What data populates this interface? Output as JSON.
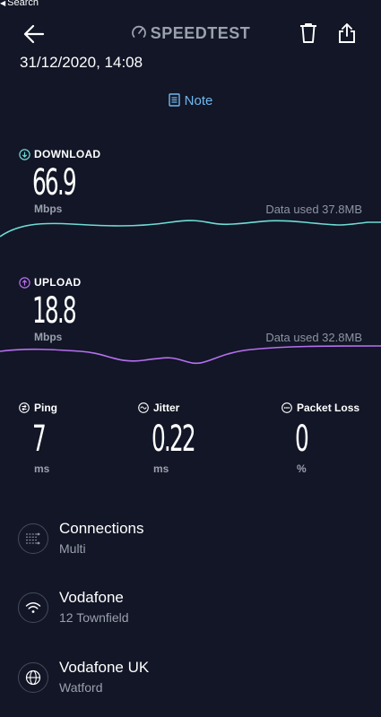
{
  "status_bar": {
    "back_label": "Search"
  },
  "header": {
    "brand": "SPEEDTEST",
    "datetime": "31/12/2020, 14:08",
    "note_label": "Note"
  },
  "download": {
    "label": "DOWNLOAD",
    "value": "66.9",
    "unit": "Mbps",
    "data_used": "Data used 37.8MB",
    "color": "#6fdcd6"
  },
  "upload": {
    "label": "UPLOAD",
    "value": "18.8",
    "unit": "Mbps",
    "data_used": "Data used 32.8MB",
    "color": "#b86ff0"
  },
  "stats": {
    "ping": {
      "label": "Ping",
      "value": "7",
      "unit": "ms"
    },
    "jitter": {
      "label": "Jitter",
      "value": "0.22",
      "unit": "ms"
    },
    "packet_loss": {
      "label": "Packet Loss",
      "value": "0",
      "unit": "%"
    }
  },
  "info": {
    "connections": {
      "title": "Connections",
      "subtitle": "Multi"
    },
    "network": {
      "title": "Vodafone",
      "subtitle": "12 Townfield"
    },
    "server": {
      "title": "Vodafone UK",
      "subtitle": "Watford"
    }
  },
  "colors": {
    "background": "#121626",
    "accent_note": "#70b8ee",
    "muted_text": "#9aa0ad"
  }
}
